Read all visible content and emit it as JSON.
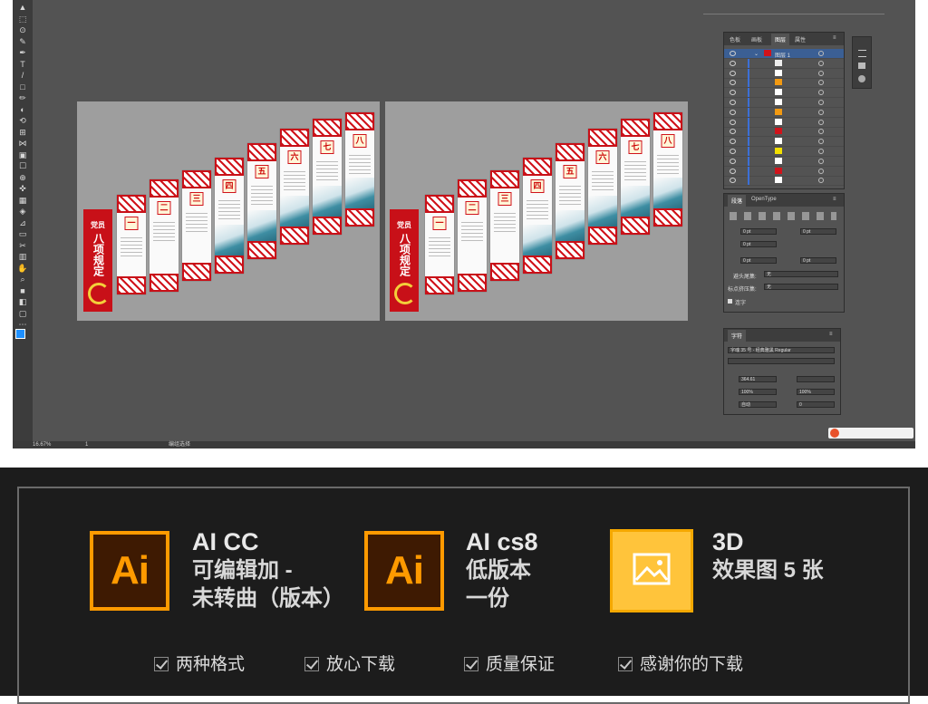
{
  "app": {
    "status_bar": {
      "zoom": "16.67%",
      "artboard_index": "1",
      "mode": "编组选择"
    },
    "layers_panel": {
      "tabs": [
        "色板",
        "画板",
        "图层",
        "属性"
      ],
      "active_tab": "图层",
      "top_layer_name": "图层 1"
    },
    "paragraph_panel": {
      "tabs": [
        "段落",
        "OpenType"
      ],
      "indent_values": [
        "0 pt",
        "0 pt",
        "0 pt",
        "0 pt",
        "0 pt"
      ],
      "avoid_head_label": "避头尾集:",
      "avoid_head_value": "无",
      "punct_label": "标点挤压集:",
      "punct_value": "无",
      "hyphen_label": "连字"
    },
    "character_panel": {
      "tab": "字符",
      "font": "字魂 35 号 - 经典雅黑 Regular",
      "font_size": "364.61",
      "scale_v": "100%",
      "scale_h": "100%",
      "leading": "自动",
      "tracking": "0",
      "kerning_extra": "0"
    }
  },
  "artwork": {
    "pillar_title": "党员",
    "pillar_text": "八项规定",
    "numerals": [
      "一",
      "二",
      "三",
      "四",
      "五",
      "六",
      "七",
      "八"
    ]
  },
  "promo": {
    "features": [
      {
        "icon": "Ai",
        "title": "AI CC",
        "lines": [
          "可编辑加 -",
          "未转曲（版本）"
        ]
      },
      {
        "icon": "Ai",
        "title": "AI cs8",
        "lines": [
          "低版本",
          "一份"
        ]
      },
      {
        "icon": "image-icon",
        "title": "3D",
        "lines": [
          "效果图 5 张"
        ]
      }
    ],
    "checklist": [
      "两种格式",
      "放心下载",
      "质量保证",
      "感谢你的下载"
    ],
    "colors": {
      "ai_orange": "#ff9a00",
      "ai_bg": "#3e1a02",
      "image_yellow": "#ffc43b",
      "promo_bg": "#1c1c1c"
    }
  }
}
